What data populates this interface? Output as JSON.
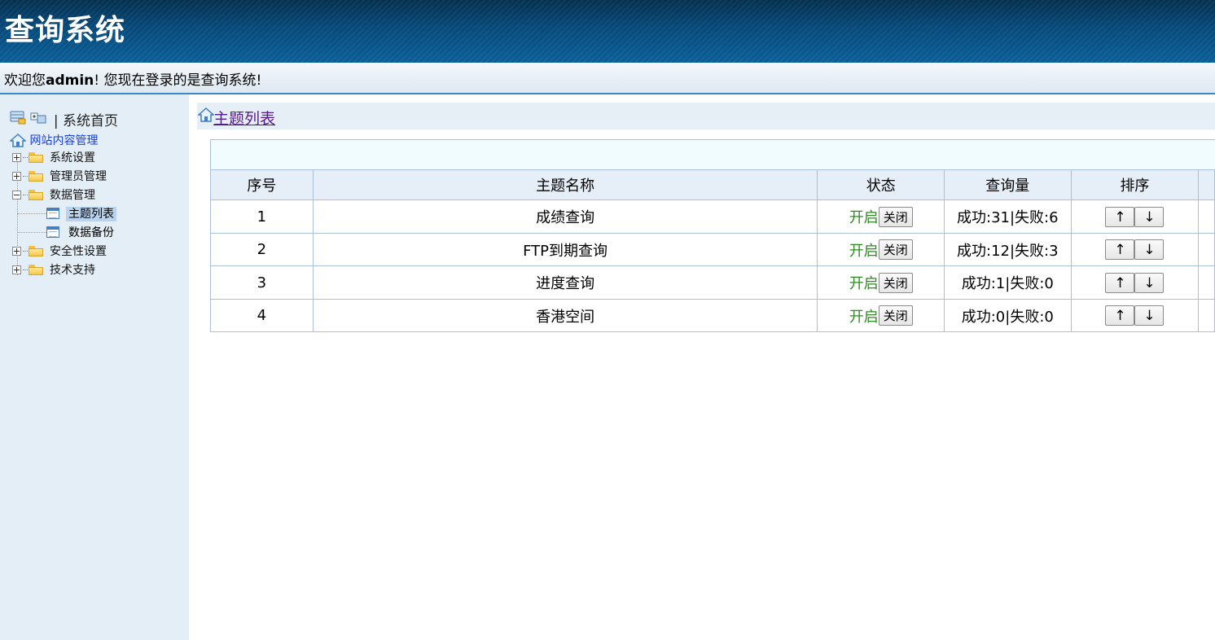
{
  "app": {
    "title": "查询系统"
  },
  "welcome": {
    "prefix": "欢迎您",
    "user": "admin",
    "suffix": "! 您现在登录的是查询系统!"
  },
  "sidebar": {
    "home_label": "系统首页",
    "root_label": "网站内容管理",
    "nodes": [
      {
        "label": "系统设置",
        "expanded": false
      },
      {
        "label": "管理员管理",
        "expanded": false
      },
      {
        "label": "数据管理",
        "expanded": true,
        "children": [
          {
            "label": "主题列表",
            "active": true
          },
          {
            "label": "数据备份",
            "active": false
          }
        ]
      },
      {
        "label": "安全性设置",
        "expanded": false
      },
      {
        "label": "技术支持",
        "expanded": false
      }
    ]
  },
  "breadcrumb": {
    "label": "主题列表"
  },
  "table": {
    "headers": [
      "序号",
      "主题名称",
      "状态",
      "查询量",
      "排序"
    ],
    "rows": [
      {
        "no": "1",
        "name": "成绩查询",
        "status": "开启",
        "toggle": "关闭",
        "stats": "成功:31|失败:6",
        "up": "↑",
        "down": "↓"
      },
      {
        "no": "2",
        "name": "FTP到期查询",
        "status": "开启",
        "toggle": "关闭",
        "stats": "成功:12|失败:3",
        "up": "↑",
        "down": "↓"
      },
      {
        "no": "3",
        "name": "进度查询",
        "status": "开启",
        "toggle": "关闭",
        "stats": "成功:1|失败:0",
        "up": "↑",
        "down": "↓"
      },
      {
        "no": "4",
        "name": "香港空间",
        "status": "开启",
        "toggle": "关闭",
        "stats": "成功:0|失败:0",
        "up": "↑",
        "down": "↓"
      }
    ]
  },
  "colors": {
    "header_dark": "#04304f",
    "header_light": "#0a5f98",
    "sidebar_bg": "#e4eef6",
    "status_on": "#2e8b22",
    "link_visited": "#551a8b",
    "tree_root": "#1a3fd6"
  }
}
